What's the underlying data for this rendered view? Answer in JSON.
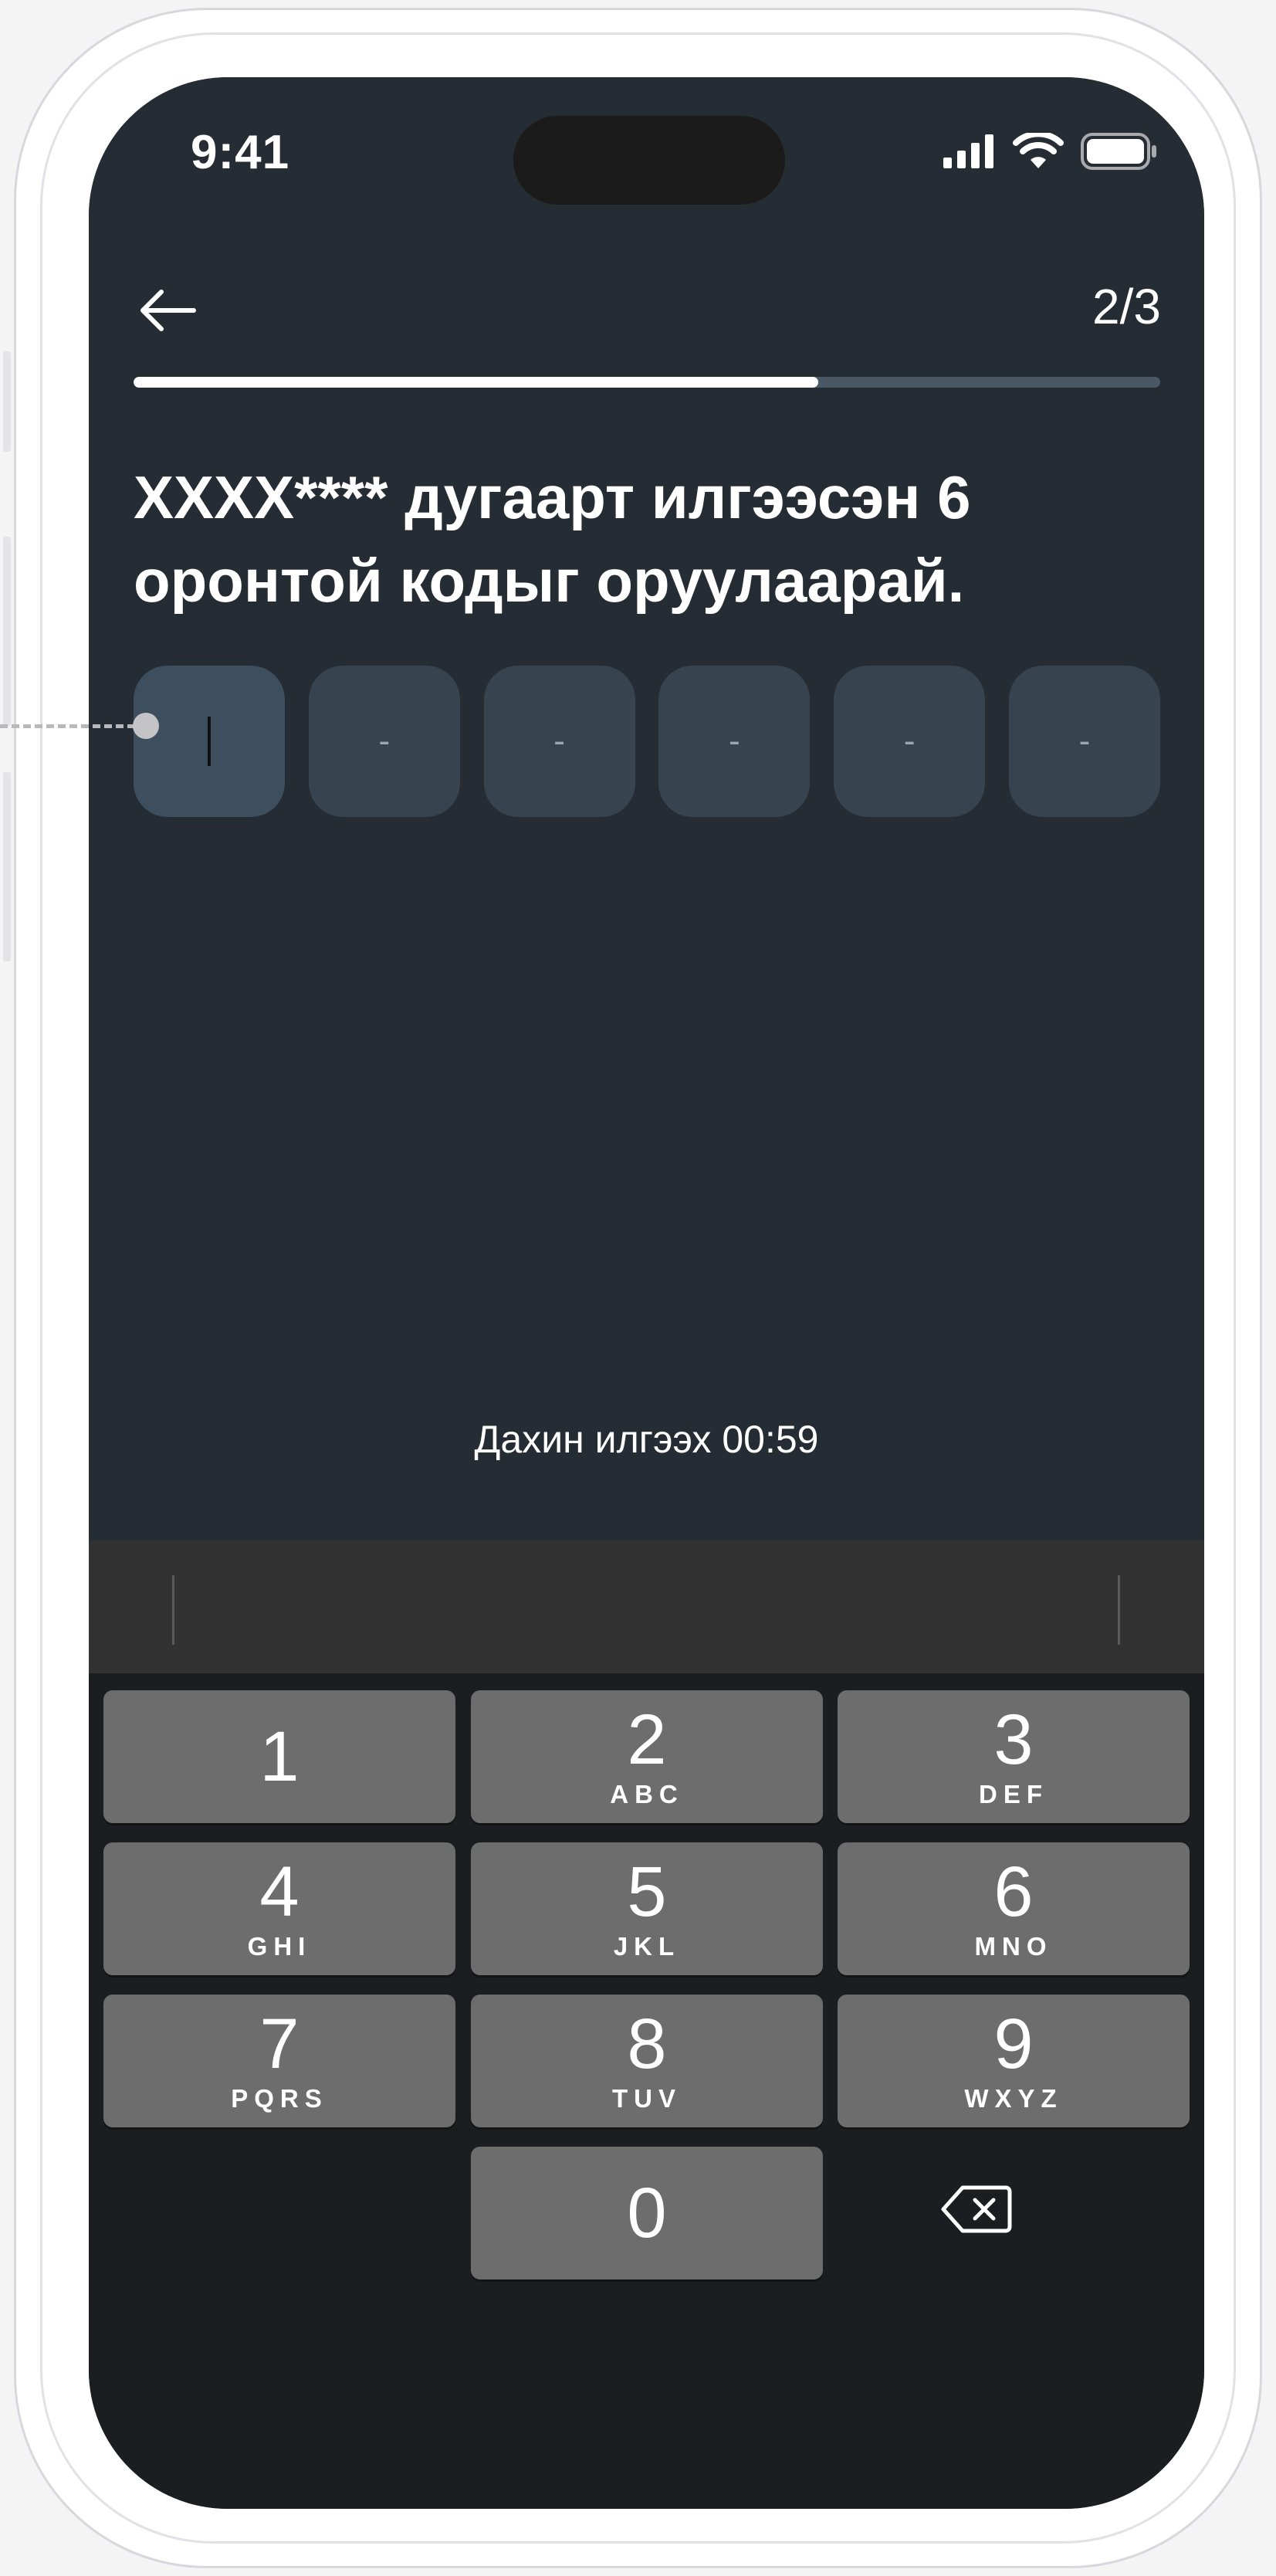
{
  "status_bar": {
    "time": "9:41",
    "icons": [
      "cellular-signal-icon",
      "wifi-icon",
      "battery-icon"
    ]
  },
  "header": {
    "back_icon": "arrow-left-icon",
    "step": "2/3"
  },
  "progress": {
    "fraction": 0.667
  },
  "heading": "XXXX**** дугаарт илгээсэн 6 оронтой кодыг оруулаарай.",
  "otp": {
    "placeholder": "-",
    "boxes": [
      "",
      "-",
      "-",
      "-",
      "-",
      "-"
    ]
  },
  "resend": {
    "label": "Дахин илгээх 00:59"
  },
  "keypad": {
    "keys": [
      {
        "digit": "1",
        "letters": ""
      },
      {
        "digit": "2",
        "letters": "ABC"
      },
      {
        "digit": "3",
        "letters": "DEF"
      },
      {
        "digit": "4",
        "letters": "GHI"
      },
      {
        "digit": "5",
        "letters": "JKL"
      },
      {
        "digit": "6",
        "letters": "MNO"
      },
      {
        "digit": "7",
        "letters": "PQRS"
      },
      {
        "digit": "8",
        "letters": "TUV"
      },
      {
        "digit": "9",
        "letters": "WXYZ"
      },
      {
        "digit": "0",
        "letters": ""
      }
    ],
    "delete_icon": "backspace-icon"
  },
  "colors": {
    "background": "#262c33",
    "otp_box": "#37434e",
    "otp_box_active": "#3d4f5f",
    "progress_track": "#4a5866",
    "key": "#6d6d6d",
    "keyboard_bg": "#1b1d21"
  }
}
